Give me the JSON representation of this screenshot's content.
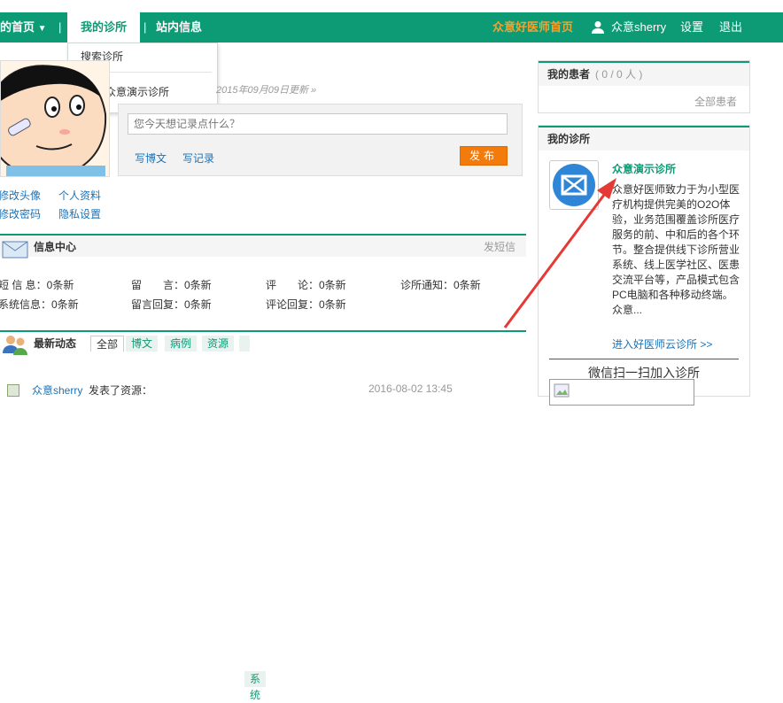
{
  "nav": {
    "home": "的首页",
    "sep1": "|",
    "my_clinic": "我的诊所",
    "sep2": "|",
    "site_msg": "站内信息",
    "doctor_home": "众意好医师首页",
    "user": "众意sherry",
    "settings": "设置",
    "logout": "退出"
  },
  "dropdown": {
    "search": "搜索诊所",
    "demo": "众意演示诊所"
  },
  "profile": {
    "updated": "2015年09月09日更新 »",
    "edit_avatar": "修改头像",
    "personal_info": "个人资料",
    "edit_password": "修改密码",
    "privacy": "隐私设置"
  },
  "post": {
    "placeholder": "您今天想记录点什么？",
    "blog": "写博文",
    "record": "写记录",
    "publish": "发布"
  },
  "info_center": {
    "title": "信息中心",
    "send_sms": "发短信",
    "rows": [
      [
        "短 信 息：0条新",
        "留　　言：0条新",
        "评　　论：0条新",
        "诊所通知：0条新"
      ],
      [
        "系统信息：0条新",
        "留言回复：0条新",
        "评论回复：0条新"
      ]
    ]
  },
  "feed": {
    "title": "最新动态",
    "tabs": [
      "全部",
      "博文",
      "病例",
      "资源",
      "系统"
    ],
    "item_user": "众意sherry",
    "item_action": "发表了资源：",
    "item_time": "2016-08-02 13:45"
  },
  "patients": {
    "title": "我的患者",
    "count": "( 0 / 0 人 )",
    "all": "全部患者"
  },
  "clinic": {
    "title": "我的诊所",
    "name": "众意演示诊所",
    "desc": "众意好医师致力于为小型医疗机构提供完美的O2O体验，业务范围覆盖诊所医疗服务的前、中和后的各个环节。整合提供线下诊所营业系统、线上医学社区、医患交流平台等，产品模式包含PC电脑和各种移动终端。 众意...",
    "join": "进入好医师云诊所 >>",
    "wechat": "微信扫一扫加入诊所"
  },
  "colors": {
    "brand_green": "#0d9b76",
    "accent_orange": "#f27b0c",
    "link_blue": "#1a73b9",
    "arrow_red": "#e53935"
  }
}
